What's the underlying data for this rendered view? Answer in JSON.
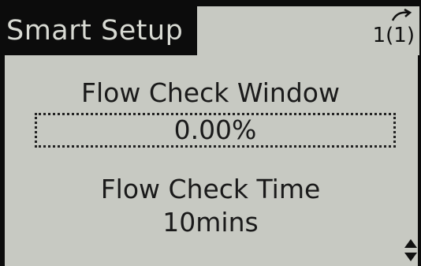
{
  "header": {
    "title": "Smart Setup",
    "page_indicator": "1(1)"
  },
  "fields": [
    {
      "label": "Flow Check Window",
      "value": "0.00%"
    },
    {
      "label": "Flow Check Time",
      "value": "10mins"
    }
  ],
  "icons": {
    "page_arrow": "page-arrow-icon",
    "scroll": "scroll-updown-icon"
  },
  "colors": {
    "lcd_background": "#c7c9c2",
    "frame": "#0c0c0c",
    "text": "#1a1a1a"
  }
}
